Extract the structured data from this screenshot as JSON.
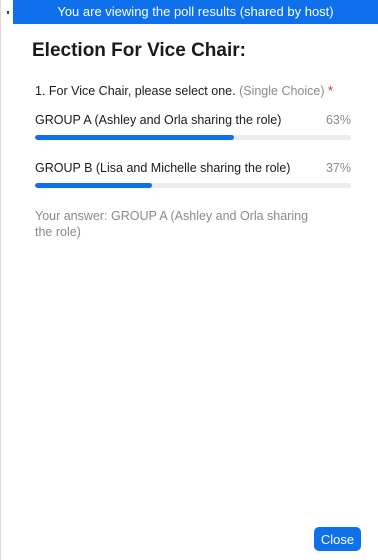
{
  "banner": {
    "text": "You are viewing the poll results (shared by host)"
  },
  "poll": {
    "title": "Election For Vice Chair:",
    "question": {
      "text": "1. For Vice Chair, please select one.",
      "type": "(Single Choice)",
      "required_marker": "*"
    },
    "options": [
      {
        "label": "GROUP A (Ashley and Orla sharing the role)",
        "percent_label": "63%",
        "fraction": 0.63
      },
      {
        "label": "GROUP B (Lisa and Michelle sharing the role)",
        "percent_label": "37%",
        "fraction": 0.37
      }
    ],
    "your_answer": "Your answer: GROUP A (Ashley and Orla sharing the role)"
  },
  "footer": {
    "close_label": "Close"
  },
  "colors": {
    "accent": "#0e71eb",
    "track": "#ececf0",
    "required": "#e02828",
    "muted_text": "#8a8a8a"
  }
}
